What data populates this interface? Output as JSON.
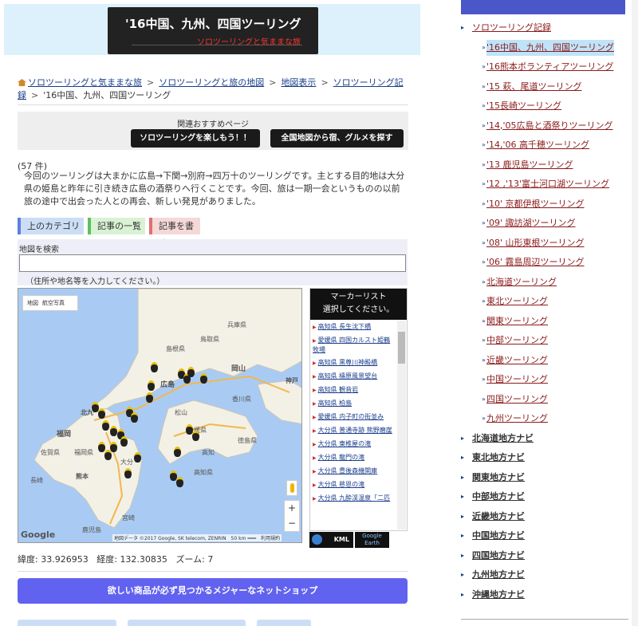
{
  "banner": {
    "title": "'16中国、九州、四国ツーリング",
    "subtitle": "ソロツーリングと気ままな旅"
  },
  "breadcrumb": [
    "ソロツーリングと気ままな旅",
    "ソロツーリングと旅の地図",
    "地図表示",
    "ソロツーリング記録",
    "'16中国、九州、四国ツーリング"
  ],
  "related": {
    "title": "関連おすすめページ",
    "button1": "ソロツーリングを楽しもう！！",
    "button2": "全国地図から宿、グルメを探す"
  },
  "count": "(57 件)",
  "description": "今回のツーリングは大まかに広島→下関→別府→四万十のツーリングです。主とする目的地は大分県の姫島と昨年に引き続き広島の酒祭りへ行くことです。今回、旅は一期一会というものの以前旅の途中で出会った人との再会、新しい発見がありました。",
  "category_buttons": {
    "up": "上のカテゴリへ",
    "list": "記事の一覧へ",
    "write": "記事を書く"
  },
  "search": {
    "label": "地図を検索",
    "value": "",
    "hint": "（住所や地名等を入力してください。）"
  },
  "map": {
    "tab_map": "地図",
    "tab_aerial": "航空写真",
    "logo": "Google",
    "attribution": "地図データ ©2017 Google, SK telecom, ZENRIN　50 km ━━━　利用規約",
    "zoom_in": "+",
    "zoom_out": "−",
    "place_labels": [
      "島根県",
      "鳥取県",
      "兵庫県",
      "岡山",
      "広島",
      "香川県",
      "福岡",
      "佐賀県",
      "長崎",
      "熊本",
      "松山",
      "高知",
      "徳島県",
      "神戸",
      "北九",
      "大分",
      "宮崎",
      "鹿児島",
      "愛媛県",
      "高知県",
      "福岡県"
    ]
  },
  "marker_panel": {
    "header_line1": "マーカーリスト",
    "header_line2": "選択してください。",
    "items": [
      "高知県 長生沈下橋",
      "愛媛県 四国カルスト姫鶴牧場",
      "高知県 黒尊川神殿橋",
      "高知県 檮原風景望台",
      "高知県 観音岩",
      "高知県 柏島",
      "愛媛県 内子町の街並み",
      "大分県 普通寺跡 熊野磨崖",
      "大分県 東椎屋の滝",
      "大分県 龍門の滝",
      "大分県 豊後森機関庫",
      "大分県 慈恩の滝",
      "大分県 九酔渓温泉「二匹"
    ]
  },
  "kml_label": "KML",
  "google_earth_line1": "Google",
  "google_earth_line2": "Earth",
  "coords": {
    "lat_label": "緯度:",
    "lat": "33.926953",
    "lng_label": "経度:",
    "lng": "132.30835",
    "zoom_label": "ズーム:",
    "zoom": "7"
  },
  "shop_button": "欲しい商品が必ず見つかるメジャーなネットショップ",
  "sidebar": [
    {
      "label": "ソロツーリング記録",
      "level": "top"
    },
    {
      "label": "'16中国、九州、四国ツーリング",
      "level": "sub",
      "highlight": true
    },
    {
      "label": "'16熊本ボランティアツーリング",
      "level": "sub"
    },
    {
      "label": "'15 萩、尾道ツーリング",
      "level": "sub"
    },
    {
      "label": "'15長崎ツーリング",
      "level": "sub"
    },
    {
      "label": "'14,'05広島と酒祭りツーリング",
      "level": "sub"
    },
    {
      "label": "'14,'06 高千穂ツーリング",
      "level": "sub"
    },
    {
      "label": "'13 鹿児島ツーリング",
      "level": "sub"
    },
    {
      "label": "'12 ,'13'富士河口湖ツーリング",
      "level": "sub"
    },
    {
      "label": "'10' 京都伊根ツーリング",
      "level": "sub"
    },
    {
      "label": "'09' 諏訪湖ツーリング",
      "level": "sub"
    },
    {
      "label": "'08' 山形東根ツーリング",
      "level": "sub"
    },
    {
      "label": "'06' 霧島周辺ツーリング",
      "level": "sub"
    },
    {
      "label": "北海道ツーリング",
      "level": "sub"
    },
    {
      "label": "東北ツーリング",
      "level": "sub"
    },
    {
      "label": "関東ツーリング",
      "level": "sub"
    },
    {
      "label": "中部ツーリング",
      "level": "sub"
    },
    {
      "label": "近畿ツーリング",
      "level": "sub"
    },
    {
      "label": "中国ツーリング",
      "level": "sub"
    },
    {
      "label": "四国ツーリング",
      "level": "sub"
    },
    {
      "label": "九州ツーリング",
      "level": "sub"
    },
    {
      "label": "北海道地方ナビ",
      "level": "bold"
    },
    {
      "label": "東北地方ナビ",
      "level": "bold"
    },
    {
      "label": "関東地方ナビ",
      "level": "bold"
    },
    {
      "label": "中部地方ナビ",
      "level": "bold"
    },
    {
      "label": "近畿地方ナビ",
      "level": "bold"
    },
    {
      "label": "中国地方ナビ",
      "level": "bold"
    },
    {
      "label": "四国地方ナビ",
      "level": "bold"
    },
    {
      "label": "九州地方ナビ",
      "level": "bold"
    },
    {
      "label": "沖縄地方ナビ",
      "level": "bold"
    }
  ],
  "colors": {
    "banner_bg": "#dcf1fb",
    "shop_button": "#6262f0",
    "sidebar_bar": "#4a57c8",
    "link": "#8b1a1a"
  }
}
